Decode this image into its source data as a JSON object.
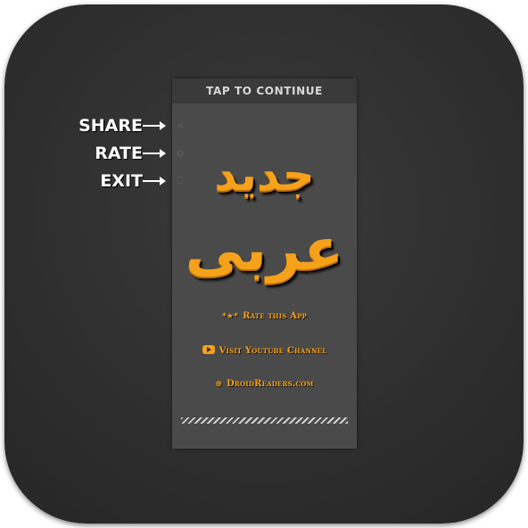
{
  "top_bar": {
    "label": "TAP TO CONTINUE"
  },
  "side_icons": [
    {
      "icon": "share-icon",
      "glyph": "<"
    },
    {
      "icon": "gear-icon",
      "glyph": "⚙"
    },
    {
      "icon": "exit-icon",
      "glyph": "⍈"
    }
  ],
  "title": {
    "line1": "جدید",
    "line2": "عربی"
  },
  "links": {
    "rate": {
      "icon": "stars-icon",
      "glyph": "*★*",
      "label": "Rate this App"
    },
    "youtube": {
      "icon": "youtube-icon",
      "label": "Visit Youtube Channel"
    },
    "site": {
      "icon": "globe-icon",
      "glyph": "⊕",
      "label": "DroidReaders.com"
    }
  },
  "callouts": {
    "share": "SHARE",
    "rate": "RATE",
    "exit": "EXIT"
  },
  "colors": {
    "accent": "#f5a11a",
    "background": "#2f2f2f",
    "screen": "#4a4a4a"
  }
}
